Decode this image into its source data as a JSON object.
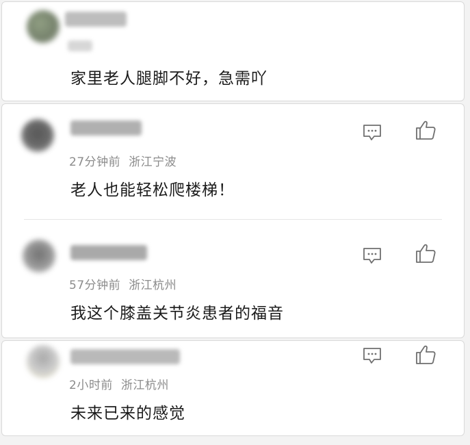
{
  "comments": [
    {
      "time": "",
      "location": "",
      "text": "家里老人腿脚不好，急需吖"
    },
    {
      "time": "27分钟前",
      "location": "浙江宁波",
      "text": "老人也能轻松爬楼梯！",
      "actions": {
        "reply_icon": "comment-icon",
        "like_icon": "thumbs-up-icon"
      }
    },
    {
      "time": "57分钟前",
      "location": "浙江杭州",
      "text": "我这个膝盖关节炎患者的福音",
      "actions": {
        "reply_icon": "comment-icon",
        "like_icon": "thumbs-up-icon"
      }
    },
    {
      "time": "2小时前",
      "location": "浙江杭州",
      "text": "未来已来的感觉",
      "actions": {
        "reply_icon": "comment-icon",
        "like_icon": "thumbs-up-icon"
      }
    }
  ],
  "colors": {
    "background": "#f3f3f3",
    "card": "#ffffff",
    "meta_text": "#8b8b8b",
    "body_text": "#1b1b1b",
    "icon_stroke": "#6f6f6f"
  }
}
